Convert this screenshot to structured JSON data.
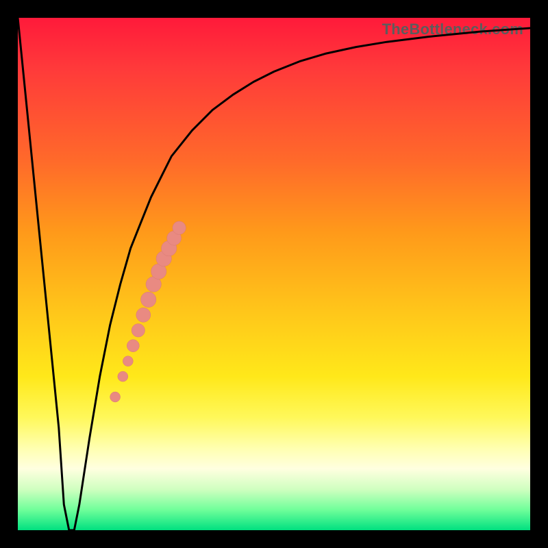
{
  "watermark": "TheBottleneck.com",
  "colors": {
    "curve_stroke": "#000000",
    "marker_fill": "#e98a82",
    "marker_stroke": "#d87a72",
    "frame": "#000000"
  },
  "chart_data": {
    "type": "line",
    "title": "",
    "xlabel": "",
    "ylabel": "",
    "xlim": [
      0,
      100
    ],
    "ylim": [
      0,
      100
    ],
    "grid": false,
    "legend": false,
    "series": [
      {
        "name": "bottleneck-curve",
        "x": [
          0,
          2,
          4,
          6,
          8,
          9,
          10,
          11,
          12,
          14,
          16,
          18,
          20,
          22,
          24,
          26,
          28,
          30,
          34,
          38,
          42,
          46,
          50,
          55,
          60,
          66,
          72,
          80,
          90,
          100
        ],
        "y": [
          100,
          80,
          60,
          40,
          20,
          5,
          0,
          0,
          5,
          18,
          30,
          40,
          48,
          55,
          60,
          65,
          69,
          73,
          78,
          82,
          85,
          87.5,
          89.5,
          91.5,
          93,
          94.3,
          95.3,
          96.3,
          97.3,
          98
        ]
      }
    ],
    "markers": [
      {
        "x": 19.0,
        "y": 26.0,
        "r": 1.0
      },
      {
        "x": 20.5,
        "y": 30.0,
        "r": 1.0
      },
      {
        "x": 21.5,
        "y": 33.0,
        "r": 1.0
      },
      {
        "x": 22.5,
        "y": 36.0,
        "r": 1.2
      },
      {
        "x": 23.5,
        "y": 39.0,
        "r": 1.3
      },
      {
        "x": 24.5,
        "y": 42.0,
        "r": 1.4
      },
      {
        "x": 25.5,
        "y": 45.0,
        "r": 1.5
      },
      {
        "x": 26.5,
        "y": 48.0,
        "r": 1.5
      },
      {
        "x": 27.5,
        "y": 50.5,
        "r": 1.5
      },
      {
        "x": 28.5,
        "y": 53.0,
        "r": 1.5
      },
      {
        "x": 29.5,
        "y": 55.0,
        "r": 1.5
      },
      {
        "x": 30.5,
        "y": 57.0,
        "r": 1.4
      },
      {
        "x": 31.5,
        "y": 59.0,
        "r": 1.3
      }
    ]
  }
}
